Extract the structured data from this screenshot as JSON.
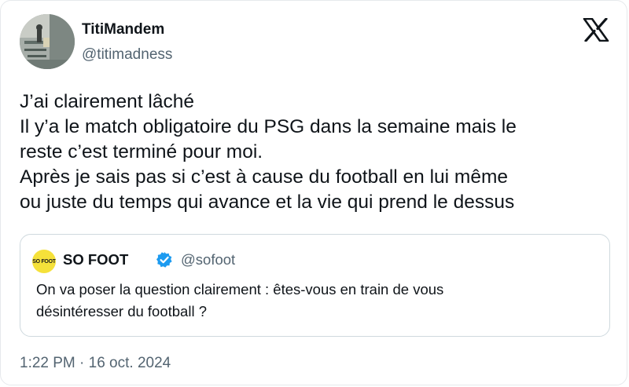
{
  "tweet": {
    "author": {
      "name": "TitiMandem",
      "handle": "@titimadness",
      "avatar_icon": "avatar-photo"
    },
    "platform_icon": "x-logo-icon",
    "text_lines": [
      "J’ai clairement lâché",
      "Il y’a le match obligatoire du PSG dans la semaine mais le",
      "reste c’est terminé pour moi.",
      "Après je sais pas si c’est à cause du football en lui même",
      "ou juste du temps qui avance et la vie qui prend le dessus"
    ],
    "quoted": {
      "avatar_text": "SO FOOT",
      "name": "SO FOOT",
      "verified_icon": "verified-badge-icon",
      "handle": "@sofoot",
      "text_lines": [
        "On va poser la question clairement : êtes-vous en train de vous",
        "désintéresser du football ?"
      ]
    },
    "timestamp": "1:22 PM · 16 oct. 2024"
  },
  "colors": {
    "text_primary": "#0f1419",
    "text_secondary": "#536471",
    "border": "#cfd9de",
    "verified_blue": "#1d9bf0",
    "sofoot_yellow": "#f5e13a"
  }
}
